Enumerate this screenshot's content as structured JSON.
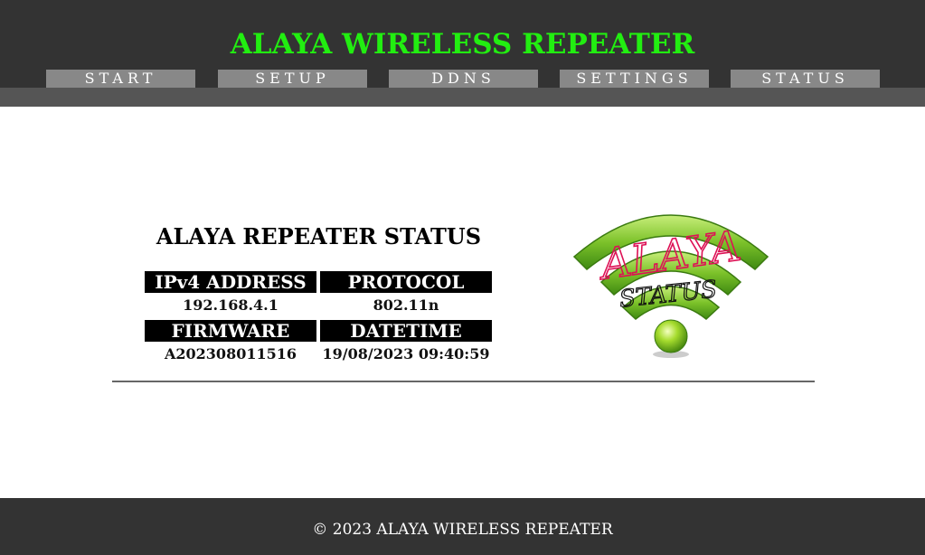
{
  "header": {
    "title": "ALAYA WIRELESS REPEATER",
    "title_color": "#22ee11",
    "background": "#333333"
  },
  "nav": {
    "items": [
      {
        "label": "START"
      },
      {
        "label": "SETUP"
      },
      {
        "label": "DDNS"
      },
      {
        "label": "SETTINGS"
      },
      {
        "label": "STATUS"
      }
    ]
  },
  "status": {
    "title": "ALAYA REPEATER STATUS",
    "ipv4_label": "IPv4 ADDRESS",
    "ipv4_value": "192.168.4.1",
    "protocol_label": "PROTOCOL",
    "protocol_value": "802.11n",
    "firmware_label": "FIRMWARE",
    "firmware_value": "A202308011516",
    "datetime_label": "DATETIME",
    "datetime_value": "19/08/2023 09:40:59"
  },
  "logo": {
    "icon": "wifi-logo-icon",
    "text_top": "ALAYA",
    "text_bottom": "STATUS",
    "text_top_color": "#dd1155",
    "arc_color": "#88cc33"
  },
  "footer": {
    "text": "© 2023 ALAYA WIRELESS REPEATER"
  }
}
